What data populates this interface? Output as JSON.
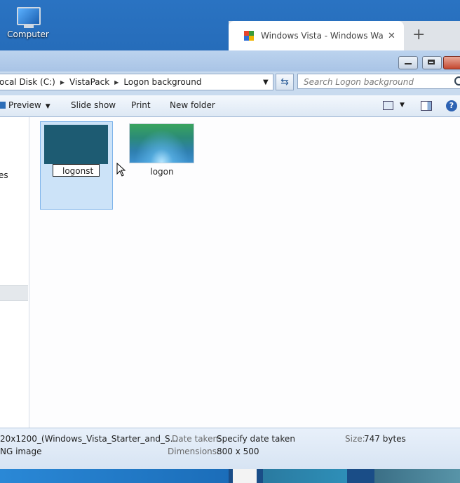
{
  "desktop": {
    "computer_label": "Computer"
  },
  "browser": {
    "tab_title": "Windows Vista - Windows Wallp",
    "tab_close": "✕",
    "new_tab": "+"
  },
  "address": {
    "crumbs": [
      "ocal Disk (C:)",
      "VistaPack",
      "Logon background"
    ],
    "search_placeholder": "Search Logon background"
  },
  "toolbar": {
    "preview": "Preview",
    "slide_show": "Slide show",
    "print": "Print",
    "new_folder": "New folder",
    "help": "?"
  },
  "nav": {
    "partial_label": "es"
  },
  "files": [
    {
      "name_editing": "logonst",
      "selected": true
    },
    {
      "name": "logon"
    }
  ],
  "details": {
    "filename": "20x1200_(Windows_Vista_Starter_and_S...",
    "filetype": "NG image",
    "date_taken_label": "Date taken:",
    "date_taken_value": "Specify date taken",
    "dimensions_label": "Dimensions:",
    "dimensions_value": "800 x 500",
    "size_label": "Size:",
    "size_value": "747 bytes"
  }
}
